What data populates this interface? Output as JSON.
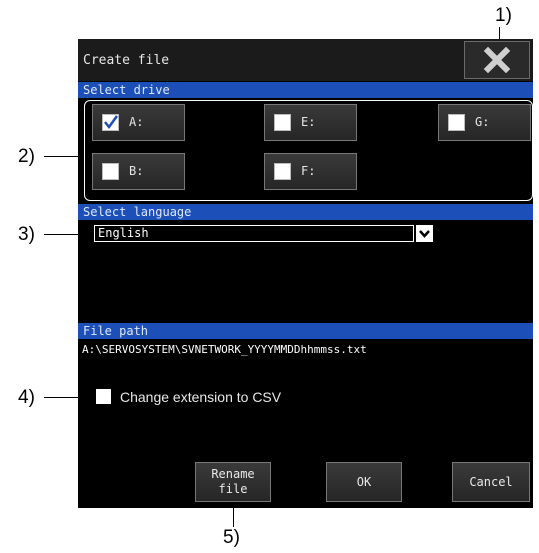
{
  "callouts": {
    "c1": "1)",
    "c2": "2)",
    "c3": "3)",
    "c4": "4)",
    "c5": "5)"
  },
  "dialog": {
    "title": "Create file",
    "close_icon": "close-x-icon"
  },
  "select_drive": {
    "header": "Select drive",
    "drives": [
      {
        "label": "A:",
        "checked": true
      },
      {
        "label": "E:",
        "checked": false
      },
      {
        "label": "G:",
        "checked": false
      },
      {
        "label": "B:",
        "checked": false
      },
      {
        "label": "F:",
        "checked": false
      }
    ]
  },
  "select_language": {
    "header": "Select language",
    "selected": "English"
  },
  "file_path": {
    "header": "File path",
    "value": "A:\\SERVOSYSTEM\\SVNETWORK_YYYYMMDDhhmmss.txt"
  },
  "csv_option": {
    "label": "Change extension to CSV",
    "checked": false
  },
  "buttons": {
    "rename_line1": "Rename",
    "rename_line2": "file",
    "ok": "OK",
    "cancel": "Cancel"
  },
  "colors": {
    "section_bar": "#1c50b8",
    "background": "#000000",
    "check_mark": "#1c50b8"
  }
}
